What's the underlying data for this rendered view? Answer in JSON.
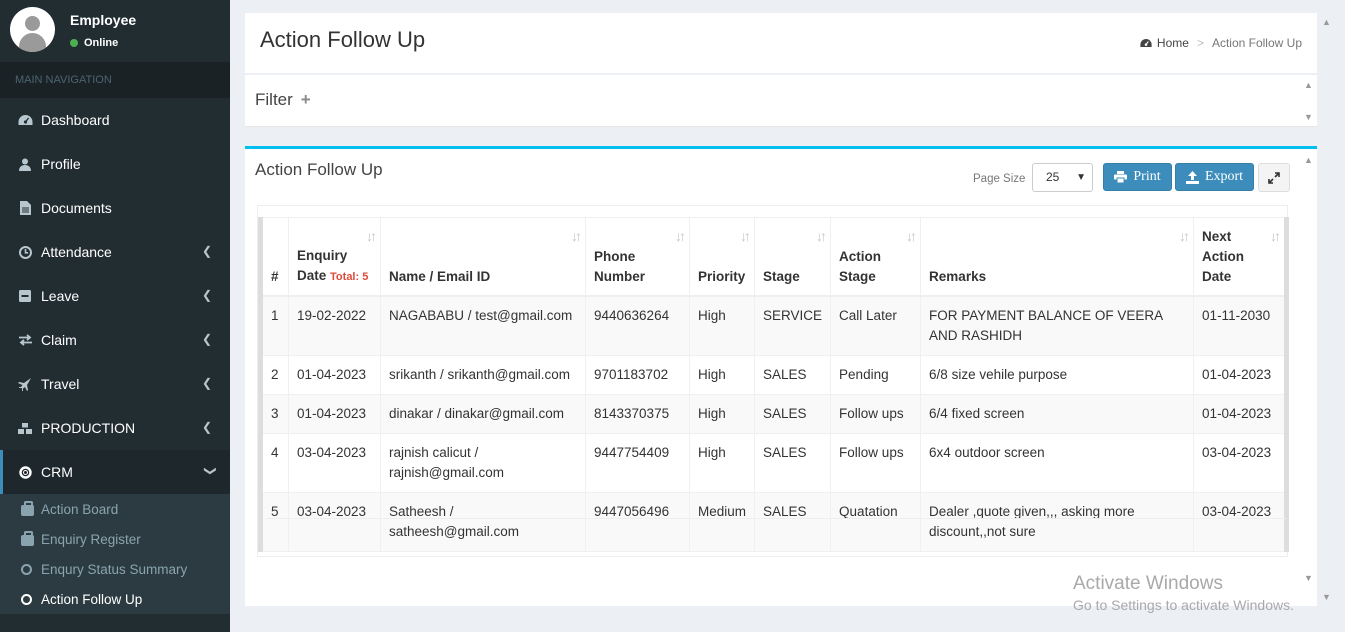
{
  "user": {
    "name": "Employee",
    "status": "Online"
  },
  "nav": {
    "header": "MAIN NAVIGATION",
    "items": [
      {
        "label": "Dashboard",
        "icon": "dashboard-icon",
        "expandable": false
      },
      {
        "label": "Profile",
        "icon": "user-icon",
        "expandable": false
      },
      {
        "label": "Documents",
        "icon": "document-icon",
        "expandable": false
      },
      {
        "label": "Attendance",
        "icon": "clock-icon",
        "expandable": true
      },
      {
        "label": "Leave",
        "icon": "minus-square-icon",
        "expandable": true
      },
      {
        "label": "Claim",
        "icon": "exchange-icon",
        "expandable": true
      },
      {
        "label": "Travel",
        "icon": "plane-icon",
        "expandable": true
      },
      {
        "label": "PRODUCTION",
        "icon": "cubes-icon",
        "expandable": true
      },
      {
        "label": "CRM",
        "icon": "life-ring-icon",
        "expandable": true
      }
    ],
    "crm_sub": [
      {
        "label": "Action Board",
        "icon": "briefcase-icon"
      },
      {
        "label": "Enquiry Register",
        "icon": "briefcase-icon"
      },
      {
        "label": "Enqury Status Summary",
        "icon": "circle-icon"
      },
      {
        "label": "Action Follow Up",
        "icon": "circle-icon"
      }
    ]
  },
  "header": {
    "title": "Action Follow Up"
  },
  "breadcrumb": {
    "home": "Home",
    "current": "Action Follow Up"
  },
  "filter": {
    "title": "Filter",
    "toggle": "+"
  },
  "box": {
    "title": "Action Follow Up",
    "page_size_label": "Page Size",
    "page_size_value": "25",
    "print_label": "Print",
    "export_label": "Export"
  },
  "table": {
    "headers": {
      "num": "#",
      "enquiry_date_1": "Enquiry",
      "enquiry_date_2": "Date",
      "total": "Total: 5",
      "name": "Name / Email ID",
      "phone_1": "Phone",
      "phone_2": "Number",
      "priority": "Priority",
      "stage": "Stage",
      "action_stage_1": "Action",
      "action_stage_2": "Stage",
      "remarks": "Remarks",
      "next_action_1": "Next Action",
      "next_action_2": "Date"
    },
    "rows": [
      {
        "num": "1",
        "date": "19-02-2022",
        "name": "NAGABABU / test@gmail.com",
        "phone": "9440636264",
        "priority": "High",
        "stage": "SERVICE",
        "action_stage": "Call Later",
        "remarks": "FOR PAYMENT BALANCE OF VEERA AND RASHIDH",
        "next": "01-11-2030"
      },
      {
        "num": "2",
        "date": "01-04-2023",
        "name": "srikanth / srikanth@gmail.com",
        "phone": "9701183702",
        "priority": "High",
        "stage": "SALES",
        "action_stage": "Pending",
        "remarks": "6/8 size vehile purpose",
        "next": "01-04-2023"
      },
      {
        "num": "3",
        "date": "01-04-2023",
        "name": "dinakar / dinakar@gmail.com",
        "phone": "8143370375",
        "priority": "High",
        "stage": "SALES",
        "action_stage": "Follow ups",
        "remarks": "6/4 fixed screen",
        "next": "01-04-2023"
      },
      {
        "num": "4",
        "date": "03-04-2023",
        "name": "rajnish calicut / rajnish@gmail.com",
        "phone": "9447754409",
        "priority": "High",
        "stage": "SALES",
        "action_stage": "Follow ups",
        "remarks": "6x4 outdoor screen",
        "next": "03-04-2023"
      },
      {
        "num": "5",
        "date": "03-04-2023",
        "name": "Satheesh / satheesh@gmail.com",
        "phone": "9447056496",
        "priority": "Medium",
        "stage": "SALES",
        "action_stage": "Quatation",
        "remarks": "Dealer ,quote given,,, asking more discount,,not sure",
        "next": "03-04-2023"
      }
    ]
  },
  "watermark": {
    "line1": "Activate Windows",
    "line2": "Go to Settings to activate Windows."
  }
}
